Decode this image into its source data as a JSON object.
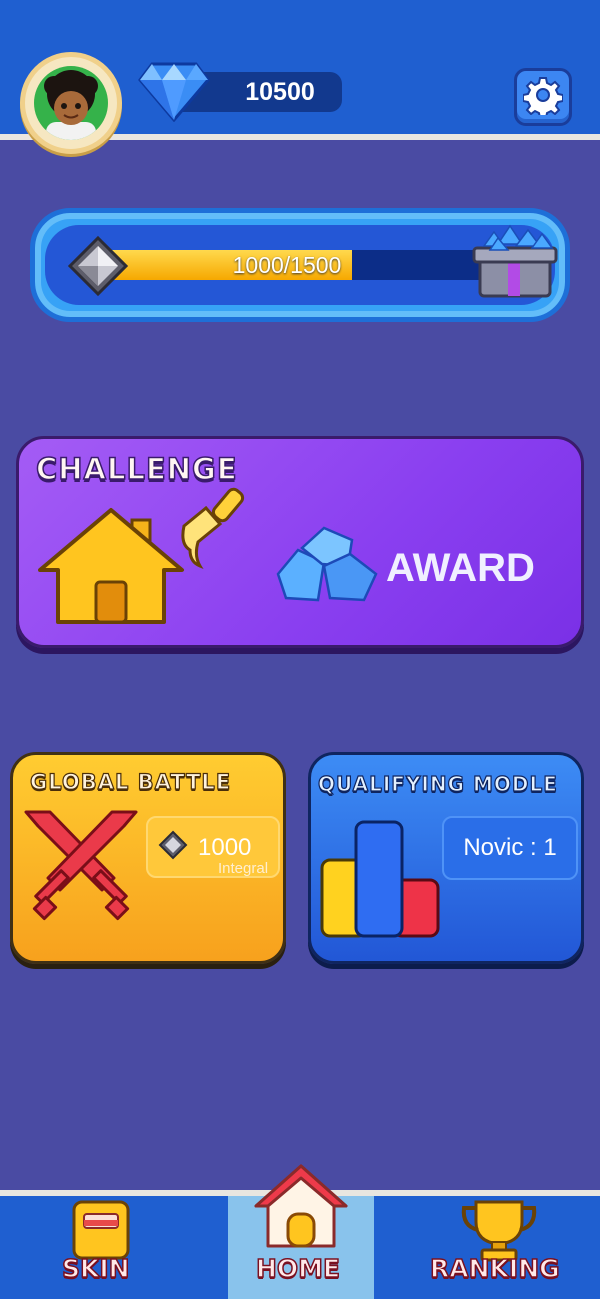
{
  "header": {
    "gem_count": "10500"
  },
  "progress": {
    "text": "1000/1500",
    "current": 1000,
    "max": 1500
  },
  "challenge": {
    "title": "CHALLENGE",
    "award_label": "AWARD"
  },
  "global_battle": {
    "title": "GLOBAL BATTLE",
    "integral_value": "1000",
    "integral_label": "Integral"
  },
  "qualifying": {
    "title": "QUALIFYING MODLE",
    "rank_text": "Novic : 1"
  },
  "nav": {
    "skin": "SKIN",
    "home": "HOME",
    "ranking": "RANKING"
  },
  "colors": {
    "background": "#4a4ba3",
    "bar_blue": "#1f5fd0",
    "challenge_purple": "#8a3ff0",
    "battle_yellow": "#f7a11d",
    "qualifying_blue": "#2257d6"
  }
}
